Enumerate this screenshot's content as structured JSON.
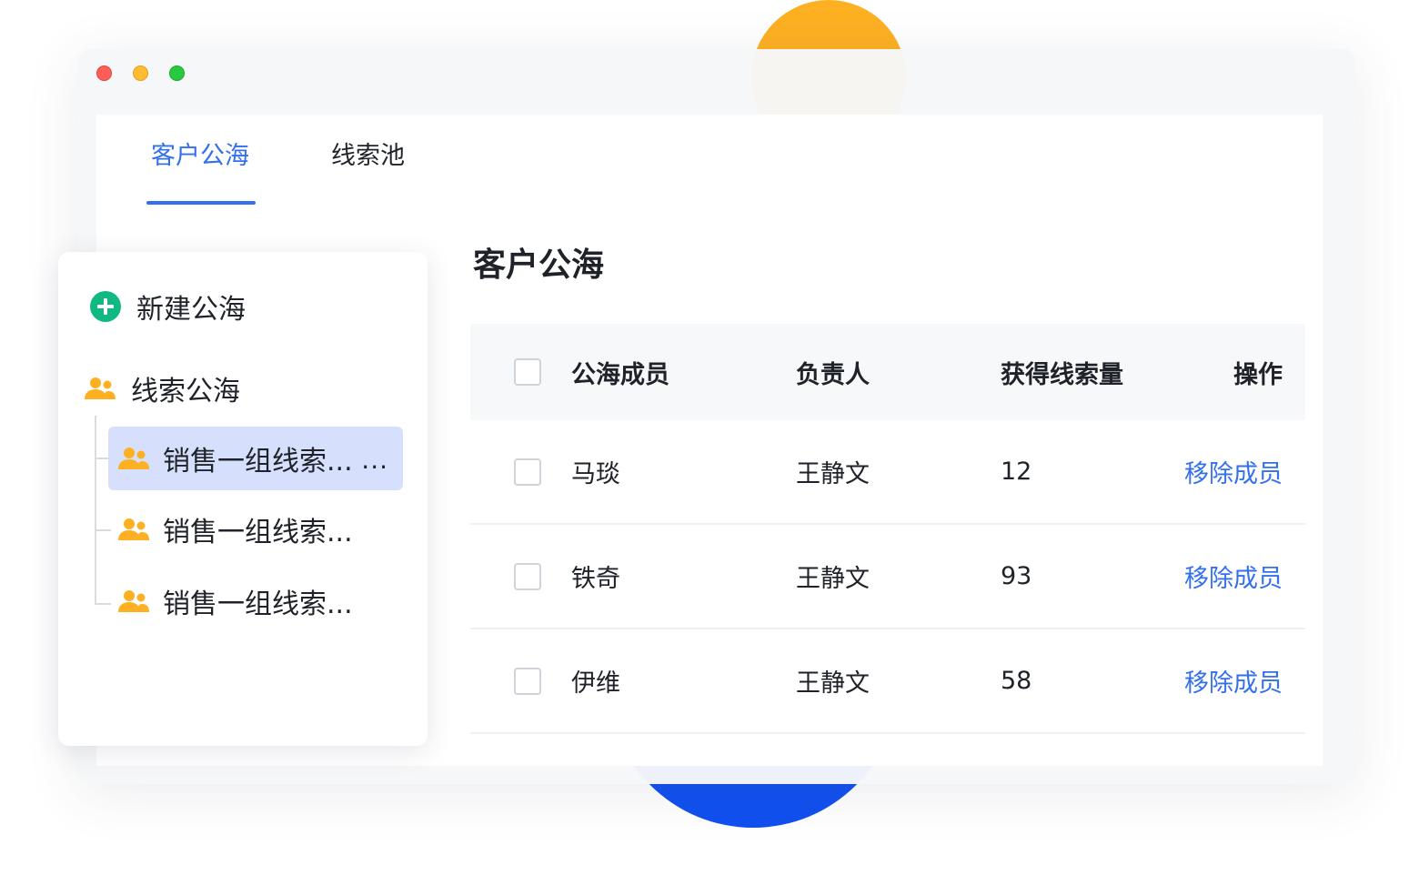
{
  "window": {
    "controls": [
      "close",
      "minimize",
      "maximize"
    ]
  },
  "tabs": [
    {
      "label": "客户公海",
      "active": true
    },
    {
      "label": "线索池",
      "active": false
    }
  ],
  "sidebar": {
    "new_button": {
      "icon": "plus-circle-icon",
      "label": "新建公海"
    },
    "root_group": {
      "icon": "people-icon",
      "label": "线索公海"
    },
    "items": [
      {
        "label": "销售一组线索...",
        "active": true,
        "more": "..."
      },
      {
        "label": "销售一组线索...",
        "active": false
      },
      {
        "label": "销售一组线索...",
        "active": false
      }
    ]
  },
  "main": {
    "title": "客户公海",
    "table": {
      "headers": {
        "name": "公海成员",
        "owner": "负责人",
        "count": "获得线索量",
        "op": "操作"
      },
      "rows": [
        {
          "name": "马琰",
          "owner": "王静文",
          "count": "12",
          "action": "移除成员"
        },
        {
          "name": "铁奇",
          "owner": "王静文",
          "count": "93",
          "action": "移除成员"
        },
        {
          "name": "伊维",
          "owner": "王静文",
          "count": "58",
          "action": "移除成员"
        }
      ]
    }
  },
  "colors": {
    "accent": "#3370eb",
    "active_item_bg": "#d6e0fd",
    "icon_orange": "#fdb022",
    "plus_green": "#10b981",
    "deco_orange": "#fdb022",
    "deco_blue": "#1150f0"
  }
}
